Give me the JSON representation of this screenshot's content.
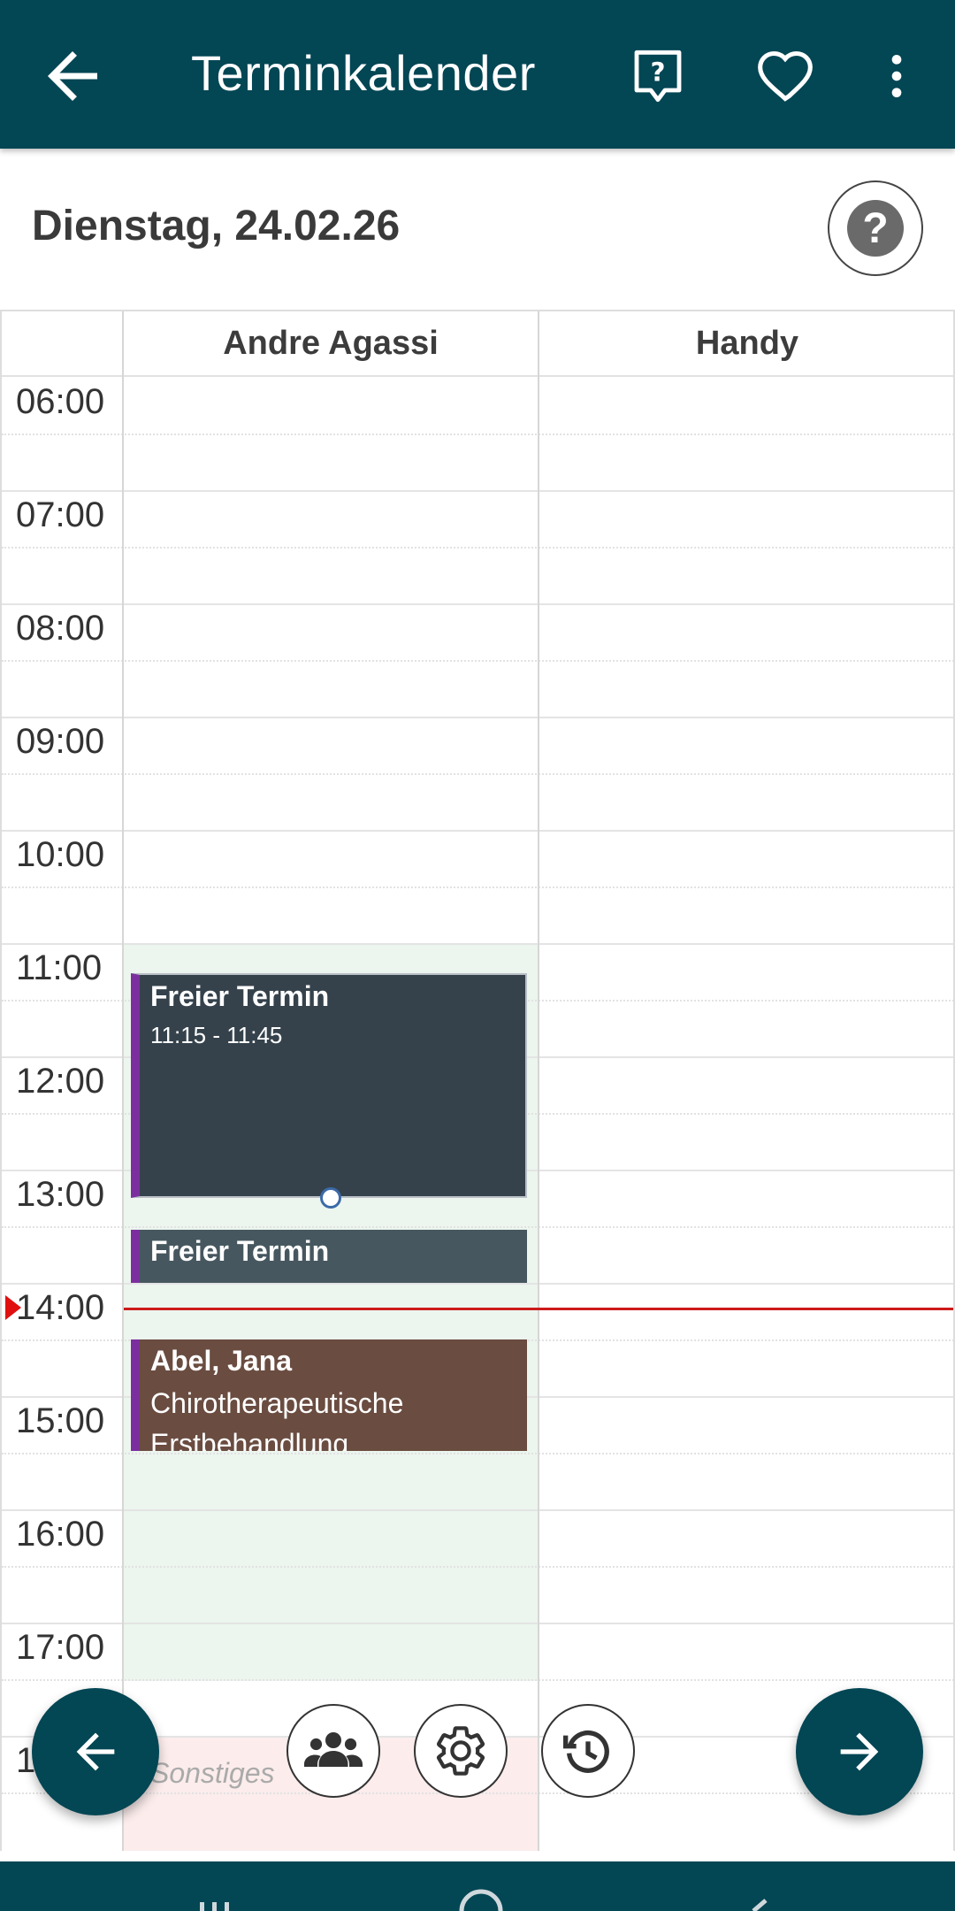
{
  "appbar": {
    "title": "Terminkalender",
    "icons": [
      "arrow-left-icon",
      "help-bubble-icon",
      "heart-icon",
      "more-vert-icon"
    ]
  },
  "date": {
    "label": "Dienstag, 24.02.26"
  },
  "columns": [
    "Andre Agassi",
    "Handy"
  ],
  "hours": [
    "06:00",
    "07:00",
    "08:00",
    "09:00",
    "10:00",
    "11:00",
    "12:00",
    "13:00",
    "14:00",
    "15:00",
    "16:00",
    "17:00",
    "1"
  ],
  "events": [
    {
      "name": "Freier Termin",
      "time": "11:15 - 11:45"
    },
    {
      "name": "Freier Termin"
    },
    {
      "name": "Abel, Jana",
      "description": "Chirotherapeutische Erstbehandlung"
    }
  ],
  "sonstiges_label": "Sonstiges",
  "colors": {
    "primary": "#034654",
    "available": "#ecf5ee",
    "now_line": "#cc1a1a",
    "event_free": "#35424c",
    "event_free_2": "#46575f",
    "event_patient": "#6a4c40",
    "event_accent": "#7b2f9e"
  },
  "bottom_icons": [
    "arrow-left-icon",
    "group-icon",
    "gear-icon",
    "history-icon",
    "arrow-right-icon"
  ]
}
